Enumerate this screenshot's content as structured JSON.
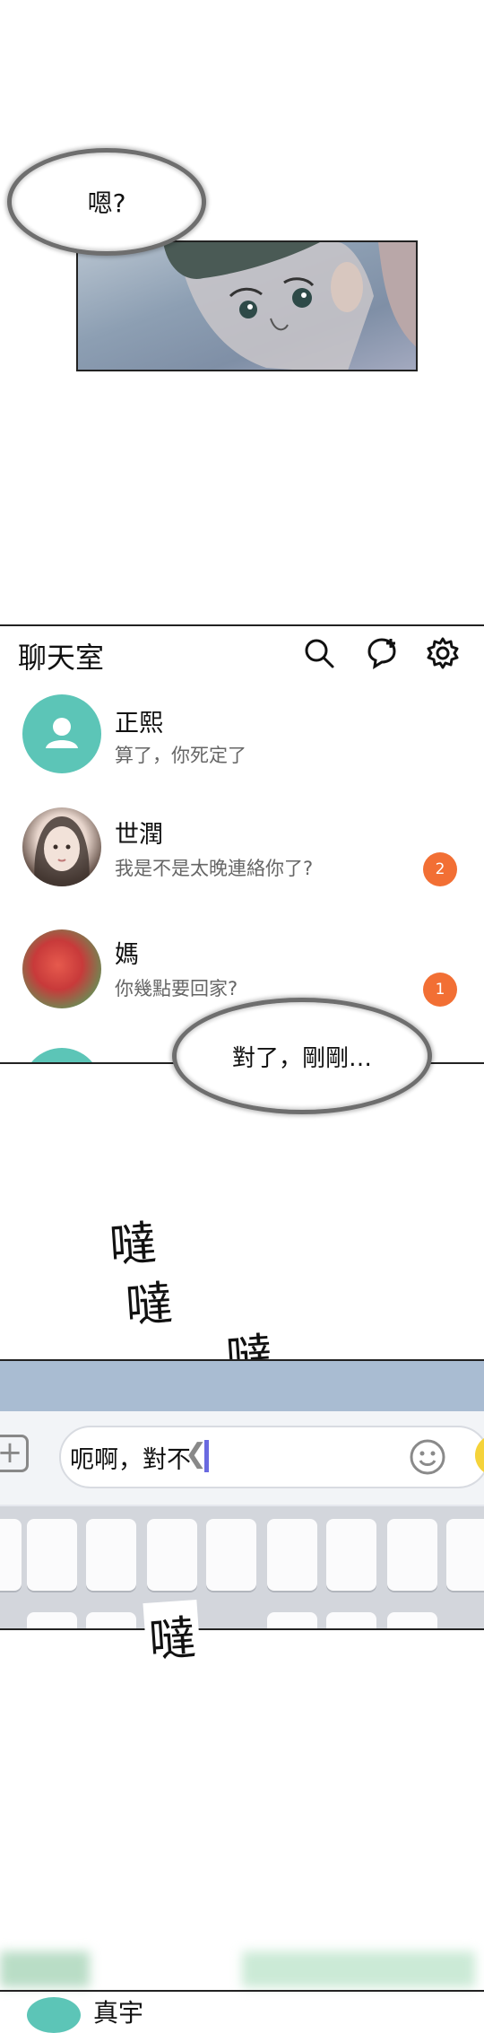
{
  "panel1": {
    "speech": "嗯?"
  },
  "chat": {
    "title": "聊天室",
    "icons": [
      "search-icon",
      "new-chat-icon",
      "gear-icon"
    ],
    "rows": [
      {
        "name": "正熙",
        "message": "算了，你死定了",
        "badge": ""
      },
      {
        "name": "世潤",
        "message": "我是不是太晚連絡你了?",
        "badge": "2"
      },
      {
        "name": "媽",
        "message": "你幾點要回家?",
        "badge": "1"
      }
    ],
    "speech": "對了，剛剛…"
  },
  "sfx": [
    "噠",
    "噠",
    "噠",
    "噠"
  ],
  "keyboard": {
    "input_text": "呃啊，對不"
  },
  "bottom": {
    "partial_text": "真宇"
  },
  "colors": {
    "accent_badge": "#f26f34",
    "avatar_default": "#5cc5b7",
    "send_button": "#f5d33a"
  }
}
